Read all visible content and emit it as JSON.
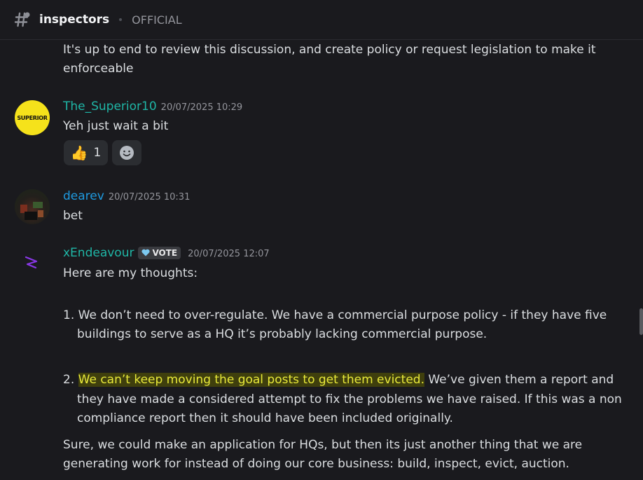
{
  "channel": {
    "name": "inspectors",
    "topic": "OFFICIAL"
  },
  "messages": [
    {
      "text": "It's up to end to review this discussion, and create policy or request legislation to make it enforceable"
    },
    {
      "author": "The_Superior10",
      "author_color": "#1fb6a6",
      "timestamp": "20/07/2025 10:29",
      "avatar_text": "SUPERIOR",
      "text": "Yeh just wait a bit",
      "reactions": [
        {
          "emoji": "👍",
          "count": "1"
        }
      ]
    },
    {
      "author": "dearev",
      "author_color": "#1e9ae0",
      "timestamp": "20/07/2025 10:31",
      "text": "bet"
    },
    {
      "author": "xEndeavour",
      "author_color": "#1fb6a6",
      "badge": "VOTE",
      "timestamp": "20/07/2025 12:07",
      "intro": "Here are my thoughts:",
      "points": [
        {
          "num": "1.",
          "line1": "We don’t need to over-regulate.  We have a commercial purpose policy - if they have five",
          "line2": "buildings to serve as a HQ it’s probably lacking commercial purpose."
        },
        {
          "num": "2.",
          "highlight": "We can’t keep moving the goal posts to get them evicted.",
          "line1_rest": " We’ve given them a report and",
          "line2": "they have made a considered attempt to fix the problems we have raised. If this was a non",
          "line3": "compliance report then it should have been included originally."
        }
      ],
      "closing_line1": "Sure, we could make an application for HQs, but then its just another thing that we are",
      "closing_line2": "generating work for instead of doing our core business: build, inspect, evict, auction."
    }
  ]
}
